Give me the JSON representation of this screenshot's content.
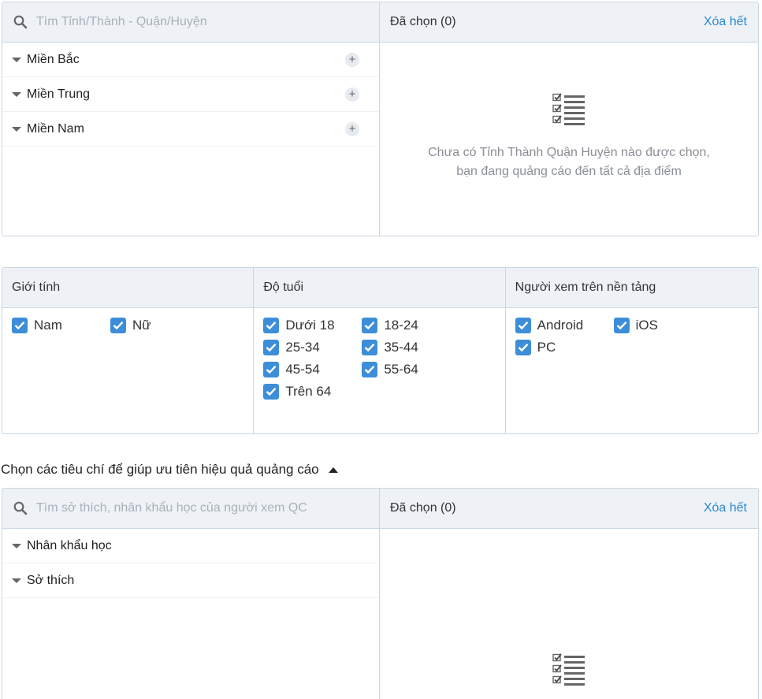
{
  "location": {
    "search_placeholder": "Tìm Tỉnh/Thành - Quận/Huyện",
    "regions": [
      {
        "label": "Miền Bắc",
        "add": "+"
      },
      {
        "label": "Miền Trung",
        "add": "+"
      },
      {
        "label": "Miền Nam",
        "add": "+"
      }
    ],
    "selected_label": "Đã chọn (0)",
    "clear_label": "Xóa hết",
    "empty_line1": "Chưa có Tỉnh Thành Quận Huyện nào được chọn,",
    "empty_line2": "bạn đang quảng cáo đến tất cả địa điểm"
  },
  "gender": {
    "title": "Giới tính",
    "options": [
      {
        "label": "Nam",
        "checked": true
      },
      {
        "label": "Nữ",
        "checked": true
      }
    ]
  },
  "age": {
    "title": "Độ tuổi",
    "options": [
      {
        "label": "Dưới 18",
        "checked": true
      },
      {
        "label": "18-24",
        "checked": true
      },
      {
        "label": "25-34",
        "checked": true
      },
      {
        "label": "35-44",
        "checked": true
      },
      {
        "label": "45-54",
        "checked": true
      },
      {
        "label": "55-64",
        "checked": true
      },
      {
        "label": "Trên 64",
        "checked": true
      }
    ]
  },
  "platform": {
    "title": "Người xem trên nền tảng",
    "options": [
      {
        "label": "Android",
        "checked": true
      },
      {
        "label": "iOS",
        "checked": true
      },
      {
        "label": "PC",
        "checked": true
      }
    ]
  },
  "criteria_toggle": "Chọn các tiêu chí để giúp ưu tiên hiệu quả quảng cáo",
  "interests": {
    "search_placeholder": "Tìm sở thích, nhân khẩu học của người xem QC",
    "groups": [
      {
        "label": "Nhân khẩu học"
      },
      {
        "label": "Sở thích"
      }
    ],
    "selected_label": "Đã chọn (0)",
    "clear_label": "Xóa hết"
  },
  "colors": {
    "accent": "#2d88d0",
    "checkbox": "#3d8ed8",
    "header_bg": "#eef2f6",
    "border": "#c9d6e3"
  }
}
